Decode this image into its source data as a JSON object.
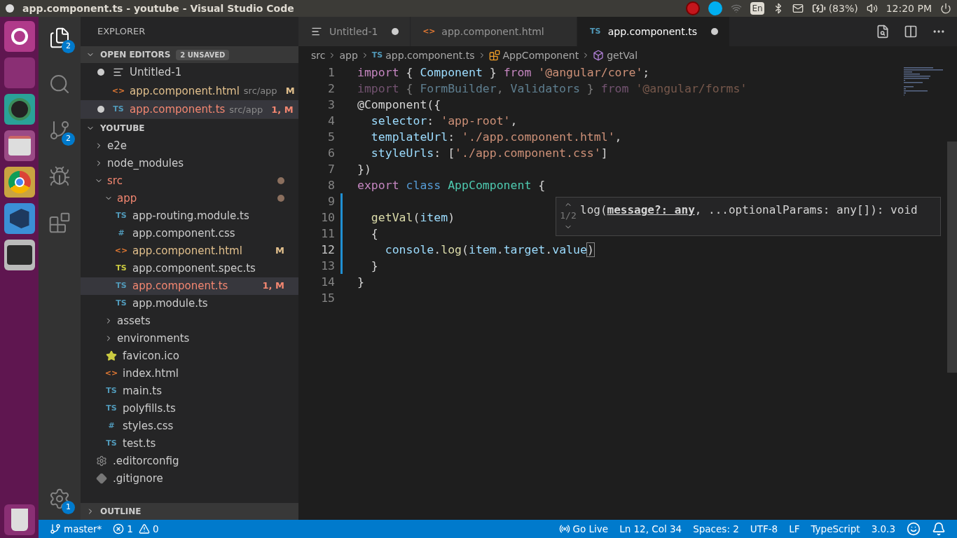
{
  "top_panel": {
    "title": "app.component.ts - youtube - Visual Studio Code",
    "keyboard": "En",
    "battery": "(83%)",
    "clock": "12:20 PM"
  },
  "launcher": [
    {
      "kind": "home"
    },
    {
      "kind": "workspaces"
    },
    {
      "kind": "camera"
    },
    {
      "kind": "files"
    },
    {
      "kind": "browser"
    },
    {
      "kind": "editor"
    },
    {
      "kind": "terminal"
    }
  ],
  "launcher_bottom": {
    "kind": "trash"
  },
  "activity_bar": [
    {
      "kind": "explorer",
      "badge": "2",
      "selected": true
    },
    {
      "kind": "search",
      "selected": false
    },
    {
      "kind": "scm",
      "badge": "2",
      "selected": false
    },
    {
      "kind": "debug",
      "selected": false
    },
    {
      "kind": "extensions",
      "selected": false
    }
  ],
  "activity_bottom": {
    "kind": "settings",
    "badge": "1"
  },
  "sidebar": {
    "title": "EXPLORER",
    "open_editors": {
      "title": "OPEN EDITORS",
      "badge": "2 UNSAVED",
      "expanded": true,
      "items": [
        {
          "name": "Untitled-1",
          "kind": "text",
          "dirty": true,
          "selected": false,
          "modified": false,
          "has_errors": false
        },
        {
          "name": "app.component.html",
          "kind": "html",
          "icon": "<>",
          "path": "src/app",
          "git": "M",
          "dirty": false,
          "selected": false,
          "modified": true,
          "has_errors": false
        },
        {
          "name": "app.component.ts",
          "kind": "ts",
          "icon": "TS",
          "path": "src/app",
          "git": "1, M",
          "dirty": true,
          "selected": true,
          "has_errors": true
        }
      ]
    },
    "workspace": {
      "title": "YOUTUBE",
      "expanded": true,
      "tree": [
        {
          "name": "e2e",
          "kind": "folder",
          "expanded": false,
          "modified": false,
          "has_errors": false,
          "selected": false
        },
        {
          "name": "node_modules",
          "kind": "folder",
          "expanded": false,
          "modified": false,
          "has_errors": false,
          "selected": false
        },
        {
          "name": "src",
          "kind": "folder",
          "expanded": true,
          "has_errors": true,
          "dot": true,
          "selected": false,
          "children": [
            {
              "name": "app",
              "kind": "folder",
              "expanded": true,
              "has_errors": true,
              "dot": true,
              "selected": false,
              "children": [
                {
                  "name": "app-routing.module.ts",
                  "kind": "ts",
                  "icon": "TS",
                  "modified": false,
                  "has_errors": false,
                  "selected": false
                },
                {
                  "name": "app.component.css",
                  "kind": "css",
                  "icon": "#",
                  "modified": false,
                  "has_errors": false,
                  "selected": false
                },
                {
                  "name": "app.component.html",
                  "kind": "html",
                  "icon": "<>",
                  "modified": true,
                  "has_errors": false,
                  "git": "M",
                  "selected": false
                },
                {
                  "name": "app.component.spec.ts",
                  "kind": "spec",
                  "icon": "TS",
                  "modified": false,
                  "has_errors": false,
                  "selected": false
                },
                {
                  "name": "app.component.ts",
                  "kind": "ts",
                  "icon": "TS",
                  "has_errors": true,
                  "git": "1, M",
                  "selected": true
                },
                {
                  "name": "app.module.ts",
                  "kind": "ts",
                  "icon": "TS",
                  "modified": false,
                  "has_errors": false,
                  "selected": false
                }
              ]
            },
            {
              "name": "assets",
              "kind": "folder",
              "expanded": false,
              "modified": false,
              "has_errors": false,
              "selected": false
            },
            {
              "name": "environments",
              "kind": "folder",
              "expanded": false,
              "modified": false,
              "has_errors": false,
              "selected": false
            },
            {
              "name": "favicon.ico",
              "kind": "favicon",
              "modified": false,
              "has_errors": false,
              "selected": false
            },
            {
              "name": "index.html",
              "kind": "html",
              "icon": "<>",
              "modified": false,
              "has_errors": false,
              "selected": false
            },
            {
              "name": "main.ts",
              "kind": "ts",
              "icon": "TS",
              "modified": false,
              "has_errors": false,
              "selected": false
            },
            {
              "name": "polyfills.ts",
              "kind": "ts",
              "icon": "TS",
              "modified": false,
              "has_errors": false,
              "selected": false
            },
            {
              "name": "styles.css",
              "kind": "css",
              "icon": "#",
              "modified": false,
              "has_errors": false,
              "selected": false
            },
            {
              "name": "test.ts",
              "kind": "ts",
              "icon": "TS",
              "modified": false,
              "has_errors": false,
              "selected": false
            }
          ]
        },
        {
          "name": ".editorconfig",
          "kind": "config",
          "modified": false,
          "has_errors": false,
          "selected": false
        },
        {
          "name": ".gitignore",
          "kind": "git",
          "modified": false,
          "has_errors": false,
          "selected": false
        }
      ]
    },
    "outline": {
      "title": "OUTLINE",
      "expanded": false
    }
  },
  "tabs": [
    {
      "label": "Untitled-1",
      "kind": "text",
      "dirty": true,
      "selected": false
    },
    {
      "label": "app.component.html",
      "kind": "html",
      "icon": "<>",
      "dirty": false,
      "selected": false
    },
    {
      "label": "app.component.ts",
      "kind": "ts",
      "icon": "TS",
      "dirty": true,
      "selected": true
    }
  ],
  "breadcrumbs": [
    {
      "label": "src",
      "kind": "folder"
    },
    {
      "label": "app",
      "kind": "folder"
    },
    {
      "label": "app.component.ts",
      "kind": "file",
      "icon": "TS"
    },
    {
      "label": "AppComponent",
      "kind": "class"
    },
    {
      "label": "getVal",
      "kind": "method"
    }
  ],
  "code": [
    {
      "number": "1",
      "current": false,
      "faded": false,
      "tokens": [
        {
          "text": "import",
          "kind": "keyword"
        },
        {
          "text": " { ",
          "kind": "punctuation"
        },
        {
          "text": "Component",
          "kind": "variable"
        },
        {
          "text": " } ",
          "kind": "punctuation"
        },
        {
          "text": "from",
          "kind": "keyword"
        },
        {
          "text": " '@angular/core'",
          "kind": "string"
        },
        {
          "text": ";",
          "kind": "punctuation"
        }
      ]
    },
    {
      "number": "2",
      "current": false,
      "faded": true,
      "tokens": [
        {
          "text": "import",
          "kind": "keyword"
        },
        {
          "text": " { ",
          "kind": "punctuation"
        },
        {
          "text": "FormBuilder",
          "kind": "variable"
        },
        {
          "text": ", ",
          "kind": "punctuation"
        },
        {
          "text": "Validators",
          "kind": "variable"
        },
        {
          "text": " } ",
          "kind": "punctuation"
        },
        {
          "text": "from",
          "kind": "keyword"
        },
        {
          "text": " '@angular/forms'",
          "kind": "string"
        }
      ]
    },
    {
      "number": "3",
      "current": false,
      "faded": false,
      "tokens": [
        {
          "text": "@Component",
          "kind": "punctuation"
        },
        {
          "text": "({",
          "kind": "punctuation"
        }
      ]
    },
    {
      "number": "4",
      "current": false,
      "faded": false,
      "tokens": [
        {
          "text": "  selector",
          "kind": "variable"
        },
        {
          "text": ": ",
          "kind": "punctuation"
        },
        {
          "text": "'app-root'",
          "kind": "string"
        },
        {
          "text": ",",
          "kind": "punctuation"
        }
      ]
    },
    {
      "number": "5",
      "current": false,
      "faded": false,
      "tokens": [
        {
          "text": "  templateUrl",
          "kind": "variable"
        },
        {
          "text": ": ",
          "kind": "punctuation"
        },
        {
          "text": "'./app.component.html'",
          "kind": "string"
        },
        {
          "text": ",",
          "kind": "punctuation"
        }
      ]
    },
    {
      "number": "6",
      "current": false,
      "faded": false,
      "tokens": [
        {
          "text": "  styleUrls",
          "kind": "variable"
        },
        {
          "text": ": [",
          "kind": "punctuation"
        },
        {
          "text": "'./app.component.css'",
          "kind": "string"
        },
        {
          "text": "]",
          "kind": "punctuation"
        }
      ]
    },
    {
      "number": "7",
      "current": false,
      "faded": false,
      "tokens": [
        {
          "text": "})",
          "kind": "punctuation"
        }
      ]
    },
    {
      "number": "8",
      "current": false,
      "faded": false,
      "tokens": [
        {
          "text": "export",
          "kind": "keyword"
        },
        {
          "text": " class",
          "kind": "storage"
        },
        {
          "text": " AppComponent",
          "kind": "type"
        },
        {
          "text": " {",
          "kind": "punctuation"
        }
      ]
    },
    {
      "number": "9",
      "current": false
    },
    {
      "number": "10",
      "current": false,
      "faded": false,
      "tokens": [
        {
          "text": "  getVal",
          "kind": "function"
        },
        {
          "text": "(",
          "kind": "punctuation"
        },
        {
          "text": "item",
          "kind": "variable"
        },
        {
          "text": ")",
          "kind": "punctuation"
        }
      ]
    },
    {
      "number": "11",
      "current": false,
      "faded": false,
      "tokens": [
        {
          "text": "  {",
          "kind": "punctuation"
        }
      ]
    },
    {
      "number": "12",
      "current": true,
      "faded": false,
      "tokens": [
        {
          "text": "    console",
          "kind": "variable"
        },
        {
          "text": ".",
          "kind": "punctuation"
        },
        {
          "text": "log",
          "kind": "function"
        },
        {
          "text": "(",
          "kind": "punctuation"
        },
        {
          "text": "item",
          "kind": "variable"
        },
        {
          "text": ".",
          "kind": "punctuation"
        },
        {
          "text": "target",
          "kind": "variable"
        },
        {
          "text": ".",
          "kind": "punctuation"
        },
        {
          "text": "value",
          "kind": "variable"
        },
        {
          "text": ")",
          "kind": "bracket"
        }
      ]
    },
    {
      "number": "13",
      "current": false,
      "faded": false,
      "tokens": [
        {
          "text": "  }",
          "kind": "punctuation"
        }
      ]
    },
    {
      "number": "14",
      "current": false,
      "faded": false,
      "tokens": [
        {
          "text": "}",
          "kind": "punctuation"
        }
      ]
    },
    {
      "number": "15",
      "current": false
    }
  ],
  "signature_help": {
    "counter": "1/2",
    "signature": "log(**message?: any**, ...optionalParams: any[]): void"
  },
  "status_bar": {
    "branch": "master*",
    "errors": "1",
    "warnings": "0",
    "items": [
      {
        "label": "Go Live",
        "kind": "broadcast"
      },
      {
        "label": "Ln 12, Col 34",
        "kind": "text"
      },
      {
        "label": "Spaces: 2",
        "kind": "text"
      },
      {
        "label": "UTF-8",
        "kind": "text"
      },
      {
        "label": "LF",
        "kind": "text"
      },
      {
        "label": "TypeScript",
        "kind": "text"
      },
      {
        "label": "3.0.3",
        "kind": "text"
      }
    ]
  }
}
